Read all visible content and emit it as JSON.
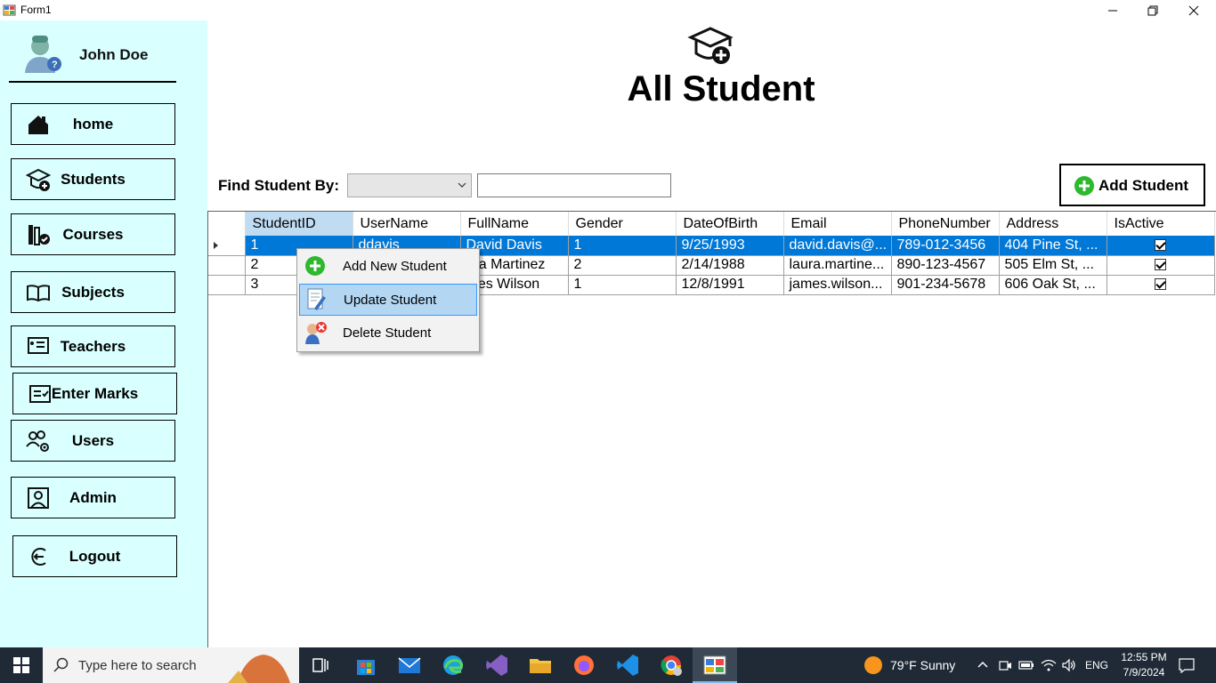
{
  "window": {
    "title": "Form1"
  },
  "sidebar": {
    "user_name": "John Doe",
    "items": [
      {
        "label": "home",
        "icon": "home-icon"
      },
      {
        "label": "Students",
        "icon": "student-cap-icon"
      },
      {
        "label": "Courses",
        "icon": "books-icon"
      },
      {
        "label": "Subjects",
        "icon": "open-book-icon"
      },
      {
        "label": "Teachers",
        "icon": "teacher-board-icon"
      },
      {
        "label": "Enter Marks",
        "icon": "marks-sheet-icon"
      },
      {
        "label": "Users",
        "icon": "users-gear-icon"
      },
      {
        "label": "Admin",
        "icon": "admin-user-icon"
      },
      {
        "label": "Logout",
        "icon": "logout-icon"
      }
    ]
  },
  "header": {
    "title": "All Student",
    "icon": "graduation-cap-add-icon"
  },
  "find": {
    "label": "Find Student By:",
    "select_value": "",
    "input_value": ""
  },
  "add_button": {
    "label": "Add Student"
  },
  "grid": {
    "columns": [
      "StudentID",
      "UserName",
      "FullName",
      "Gender",
      "DateOfBirth",
      "Email",
      "PhoneNumber",
      "Address",
      "IsActive"
    ],
    "rows": [
      {
        "id": "1",
        "username": "ddavis",
        "fullname": "David Davis",
        "gender": "1",
        "dob": "9/25/1993",
        "email": "david.davis@...",
        "phone": "789-012-3456",
        "address": "404 Pine St, ...",
        "active": true
      },
      {
        "id": "2",
        "username": "",
        "fullname": "ura Martinez",
        "gender": "2",
        "dob": "2/14/1988",
        "email": "laura.martine...",
        "phone": "890-123-4567",
        "address": "505 Elm St, ...",
        "active": true
      },
      {
        "id": "3",
        "username": "",
        "fullname": "mes Wilson",
        "gender": "1",
        "dob": "12/8/1991",
        "email": "james.wilson...",
        "phone": "901-234-5678",
        "address": "606 Oak St, ...",
        "active": true
      }
    ]
  },
  "context_menu": {
    "items": [
      {
        "label": "Add New Student",
        "icon": "add-green-icon"
      },
      {
        "label": "Update Student",
        "icon": "edit-document-icon"
      },
      {
        "label": "Delete Student",
        "icon": "delete-user-icon"
      }
    ]
  },
  "taskbar": {
    "search_placeholder": "Type here to search",
    "weather": "79°F  Sunny",
    "lang": "ENG",
    "time": "12:55 PM",
    "date": "7/9/2024"
  },
  "colors": {
    "sidebar_bg": "#d9ffff",
    "selection": "#0078d7",
    "menu_hover": "#b3d7f3",
    "add_green": "#2eb82e"
  }
}
